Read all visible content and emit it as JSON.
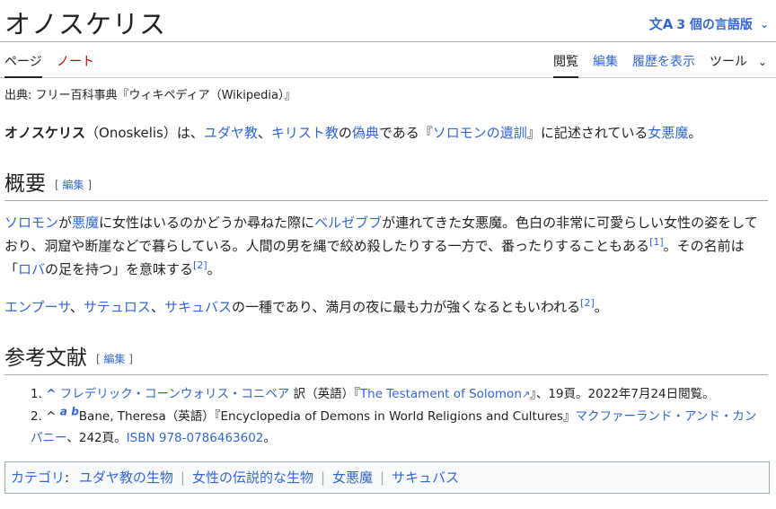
{
  "header": {
    "title": "オノスケリス",
    "lang_button": "3 個の言語版",
    "lang_icon": "文A"
  },
  "tabs": {
    "page": "ページ",
    "talk": "ノート",
    "read": "閲覧",
    "edit": "編集",
    "history": "履歴を表示",
    "tools": "ツール"
  },
  "sitesub": "出典: フリー百科事典『ウィキペディア（Wikipedia）』",
  "lead": {
    "bold": "オノスケリス",
    "t1": "（Onoskelis）は、",
    "l1": "ユダヤ教",
    "t2": "、",
    "l2": "キリスト教",
    "t3": "の",
    "l3": "偽典",
    "t4": "である『",
    "l4": "ソロモンの遺訓",
    "t5": "』に記述されている",
    "l5": "女悪魔",
    "t6": "。"
  },
  "section1": {
    "heading": "概要",
    "edit": "編集",
    "p1": {
      "l1": "ソロモン",
      "t1": "が",
      "l2": "悪魔",
      "t2": "に女性はいるのかどうか尋ねた際に",
      "l3": "ベルゼブブ",
      "t3": "が連れてきた女悪魔。色白の非常に可愛らしい女性の姿をしており、洞窟や断崖などで暮らしている。人間の男を縄で絞め殺したりする一方で、番ったりすることもある",
      "ref1": "[1]",
      "t4": "。その名前は「",
      "l4": "ロバ",
      "t5": "の足を持つ」を意味する",
      "ref2": "[2]",
      "t6": "。"
    },
    "p2": {
      "l1": "エンプーサ",
      "t1": "、",
      "l2": "サテュロス",
      "t2": "、",
      "l3": "サキュバス",
      "t3": "の一種であり、満月の夜に最も力が強くなるともいわれる",
      "ref": "[2]",
      "t4": "。"
    }
  },
  "section2": {
    "heading": "参考文献",
    "edit": "編集",
    "ref1": {
      "num": "1.",
      "caret": "^",
      "author": "フレデリック・コーンウォリス・コニベア",
      "t1": " 訳（英語）『",
      "title": "The Testament of Solomon",
      "t2": "』、19頁。2022年7月24日閲覧。"
    },
    "ref2": {
      "num": "2.",
      "caret": "^",
      "a": "a",
      "b": "b",
      "t1": "Bane, Theresa（英語）『Encyclopedia of Demons in World Religions and Cultures』",
      "publisher": "マクファーランド・アンド・カンパニー",
      "t2": "、242頁。",
      "isbn": "ISBN 978-0786463602",
      "t3": "。"
    }
  },
  "categories": {
    "label": "カテゴリ",
    "items": [
      "ユダヤ教の生物",
      "女性の伝説的な生物",
      "女悪魔",
      "サキュバス"
    ]
  }
}
